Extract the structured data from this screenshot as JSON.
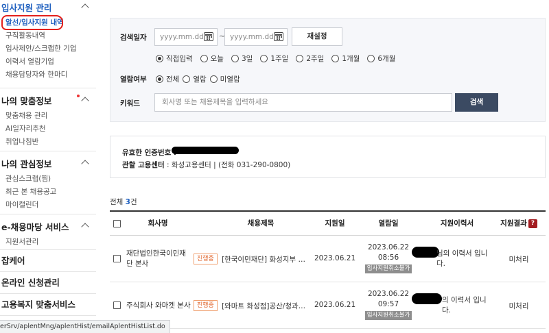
{
  "sidebar": {
    "sections": [
      {
        "title": "입사지원 관리",
        "items": [
          "알선/입사지원 내역",
          "구직활동내역",
          "입사제안/스크랩한 기업",
          "이력서 열람기업",
          "채용담당자와 한마디"
        ]
      },
      {
        "title": "나의 맞춤정보",
        "items": [
          "맞춤채용 관리",
          "AI일자리추천",
          "취업나침반"
        ]
      },
      {
        "title": "나의 관심정보",
        "items": [
          "관심스크랩(찜)",
          "최근 본 채용공고",
          "마이캘린더"
        ]
      },
      {
        "title": "e-채용마당 서비스",
        "items": [
          "지원서관리"
        ]
      },
      {
        "title": "잡케어",
        "items": []
      },
      {
        "title": "온라인 신청관리",
        "items": []
      },
      {
        "title": "고용복지 맞춤서비스",
        "items": []
      }
    ],
    "status_url": "erSrv/aplentMng/aplentHist/emailAplentHistList.do"
  },
  "search": {
    "date_label": "검색일자",
    "date_placeholder": "yyyy.mm.dd",
    "tilde": "~",
    "reset_label": "재설정",
    "period_options": [
      "직접입력",
      "오늘",
      "3일",
      "1주일",
      "2주일",
      "1개월",
      "6개월"
    ],
    "read_label": "열람여부",
    "read_options": [
      "전체",
      "열람",
      "미열람"
    ],
    "keyword_label": "키워드",
    "keyword_placeholder": "회사명 또는 채용제목을 입력하세요",
    "search_label": "검색"
  },
  "info": {
    "cert_label": "유효한 인증번호 :",
    "center_label": "관할 고용센터",
    "center_value": " : 화성고용센터 | (전화 031-290-0800)"
  },
  "count": {
    "prefix": "전체 ",
    "number": "3",
    "suffix": "건"
  },
  "table": {
    "headers": [
      "회사명",
      "채용제목",
      "지원일",
      "열람일",
      "지원이력서",
      "지원결과"
    ],
    "help_icon": "?",
    "rows": [
      {
        "company": "재단법인한국이민재단 본사",
        "status": "진행중",
        "title": "[한국이민재단] 화성지부 매…",
        "apply_date": "2023.06.21",
        "read_date": "2023.06.22",
        "read_time": "08:56",
        "cancel_tag": "입사지원취소불가",
        "resume": "님의 이력서 입니다.",
        "result": "미처리"
      },
      {
        "company": "주식회사 와마켓 본사",
        "status": "진행중",
        "title": "[와마트 화성점]공산/청과 …",
        "apply_date": "2023.06.21",
        "read_date": "2023.06.22",
        "read_time": "09:57",
        "cancel_tag": "입사지원취소불가",
        "resume": "의 이력서 입니다.",
        "result": "미처리"
      }
    ]
  },
  "colors": {
    "accent_blue": "#1e5fbf",
    "search_button": "#3b4a62",
    "highlight_circle": "#e3201b",
    "status_badge": "#e0642a"
  }
}
